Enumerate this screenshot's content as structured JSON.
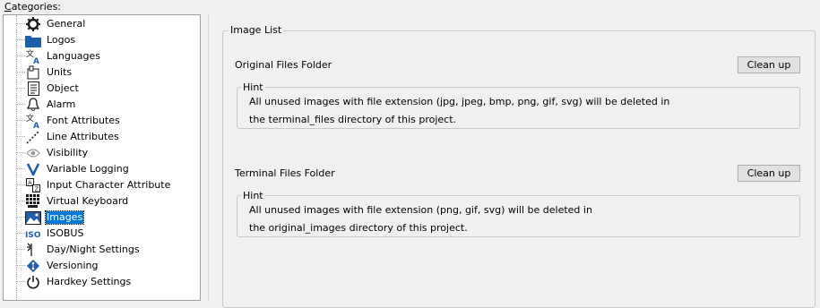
{
  "categories_label": "Categories:",
  "categories_label_mnemonic": "C",
  "categories_label_rest": "ategories:",
  "tree_items": [
    {
      "label": "General",
      "icon": "gear-icon"
    },
    {
      "label": "Logos",
      "icon": "folder-icon"
    },
    {
      "label": "Languages",
      "icon": "language-icon"
    },
    {
      "label": "Units",
      "icon": "units-icon"
    },
    {
      "label": "Object",
      "icon": "document-icon"
    },
    {
      "label": "Alarm",
      "icon": "bell-icon"
    },
    {
      "label": "Font Attributes",
      "icon": "font-icon"
    },
    {
      "label": "Line Attributes",
      "icon": "line-icon"
    },
    {
      "label": "Visibility",
      "icon": "eye-icon"
    },
    {
      "label": "Variable Logging",
      "icon": "v-icon"
    },
    {
      "label": "Input Character Attribute",
      "icon": "input-char-icon"
    },
    {
      "label": "Virtual Keyboard",
      "icon": "keyboard-icon"
    },
    {
      "label": "Images",
      "icon": "image-icon",
      "selected": true
    },
    {
      "label": "ISOBUS",
      "icon": "iso-icon"
    },
    {
      "label": "Day/Night Settings",
      "icon": "day-night-icon"
    },
    {
      "label": "Versioning",
      "icon": "versioning-icon"
    },
    {
      "label": "Hardkey Settings",
      "icon": "power-icon"
    }
  ],
  "image_list": {
    "title": "Image List",
    "original": {
      "label": "Original Files Folder",
      "button": "Clean up",
      "hint_title": "Hint",
      "hint_line1": "All unused images with file extension (jpg, jpeg, bmp, png, gif, svg) will be deleted in",
      "hint_line2": "the terminal_files directory of this project."
    },
    "terminal": {
      "label": "Terminal Files Folder",
      "button": "Clean up",
      "hint_title": "Hint",
      "hint_line1": "All unused images with file extension (png, gif, svg) will be deleted in",
      "hint_line2": "the original_images directory of this project."
    }
  },
  "colors": {
    "selection": "#0078d7",
    "icon_blue": "#1f5fa8",
    "icon_dark": "#1b1b1b"
  }
}
